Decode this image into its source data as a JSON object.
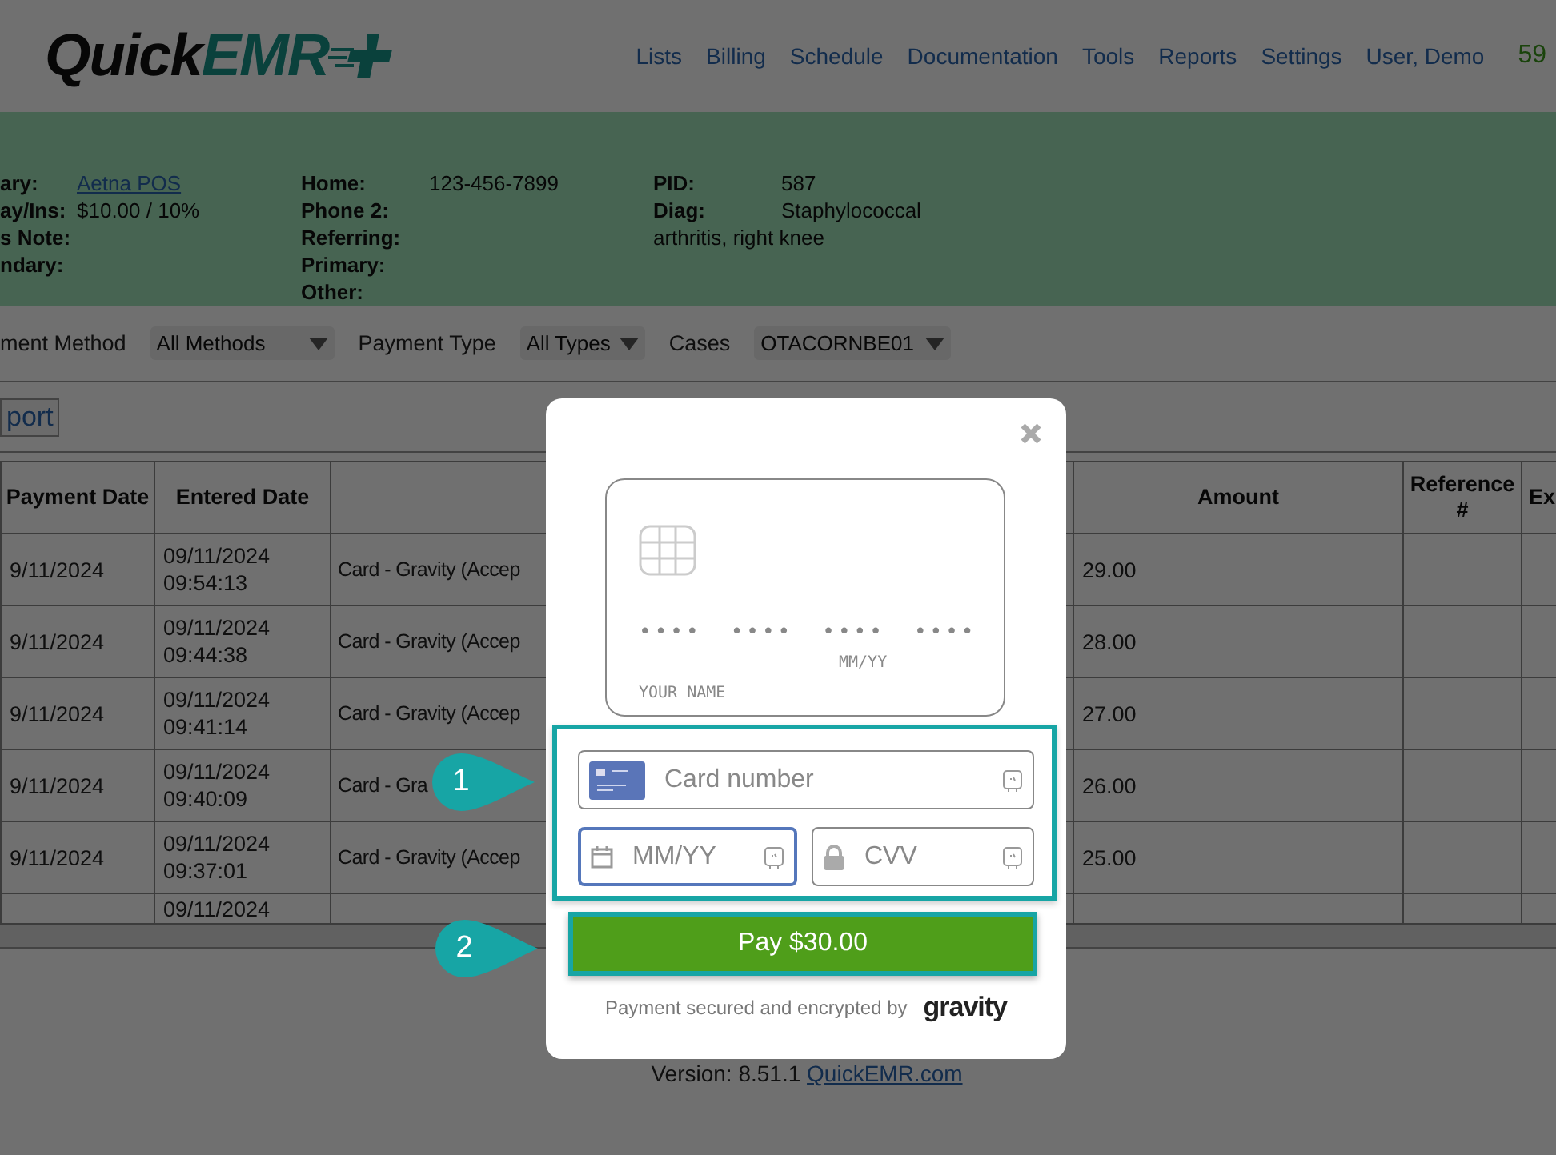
{
  "header": {
    "logo": {
      "part_1": "Quick",
      "part_2": "EMR"
    },
    "nav": [
      "Lists",
      "Billing",
      "Schedule",
      "Documentation",
      "Tools",
      "Reports",
      "Settings",
      "User, Demo"
    ],
    "counter": "59"
  },
  "patient_panel": {
    "columns": [
      [
        {
          "label": "ary:",
          "value": "Aetna POS",
          "link": true
        },
        {
          "label": "ay/Ins:",
          "value": "$10.00 / 10%"
        },
        {
          "label": "s Note:"
        },
        {
          "label": "ndary:"
        }
      ],
      [
        {
          "label": "Home:",
          "value": "123-456-7899"
        },
        {
          "label": "Phone 2:"
        },
        {
          "label": "Referring:"
        },
        {
          "label": "Primary:"
        },
        {
          "label": "Other:"
        }
      ],
      [
        {
          "label": "PID:",
          "value": "587"
        },
        {
          "label": "Diag:",
          "value": "Staphylococcal"
        },
        {
          "value": "arthritis, right knee"
        }
      ]
    ]
  },
  "filters": [
    {
      "label": "ment Method",
      "value": "All Methods"
    },
    {
      "label": "Payment Type",
      "value": "All Types"
    },
    {
      "label": "Cases",
      "value": "OTACORNBE01"
    }
  ],
  "toolbar": {
    "button": "port"
  },
  "table": {
    "columns": [
      {
        "label": "Payment Date"
      },
      {
        "label": "Entered Date"
      },
      {},
      {
        "label": "Amount"
      },
      {
        "label": "Reference #"
      },
      {
        "label": "Ex"
      }
    ],
    "rows": [
      {
        "payment_date": "9/11/2024",
        "entered_date": "09/11/2024",
        "entered_time": "09:54:13",
        "description": "Card - Gravity (Accep",
        "amount": "29.00"
      },
      {
        "payment_date": "9/11/2024",
        "entered_date": "09/11/2024",
        "entered_time": "09:44:38",
        "description": "Card - Gravity (Accep",
        "amount": "28.00"
      },
      {
        "payment_date": "9/11/2024",
        "entered_date": "09/11/2024",
        "entered_time": "09:41:14",
        "description": "Card - Gravity (Accep",
        "amount": "27.00"
      },
      {
        "payment_date": "9/11/2024",
        "entered_date": "09/11/2024",
        "entered_time": "09:40:09",
        "description": "Card - Gra",
        "amount": "26.00"
      },
      {
        "payment_date": "9/11/2024",
        "entered_date": "09/11/2024",
        "entered_time": "09:37:01",
        "description": "Card - Gravity (Accep",
        "amount": "25.00"
      },
      {
        "entered_date": "09/11/2024"
      }
    ]
  },
  "version": {
    "text": "Version: 8.51.1",
    "link": "QuickEMR.com"
  },
  "modal": {
    "card_preview": {
      "dots": [
        "••••",
        "••••",
        "••••",
        "••••"
      ],
      "expiry": "MM/YY",
      "name": "YOUR NAME"
    },
    "fields": [
      {
        "kind": "card",
        "placeholder": "Card number",
        "focused": false
      },
      {
        "kind": "expiry",
        "placeholder": "MM/YY",
        "focused": true
      },
      {
        "kind": "cvv",
        "placeholder": "CVV",
        "focused": false
      }
    ],
    "pay_button": "Pay $30.00",
    "footer": {
      "text": "Payment secured and encrypted by",
      "brand": "gravity"
    }
  },
  "callouts": [
    {
      "label": "1"
    },
    {
      "label": "2"
    }
  ]
}
